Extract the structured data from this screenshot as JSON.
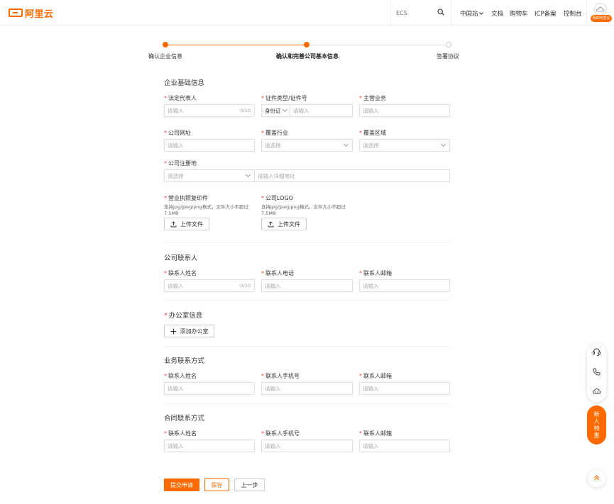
{
  "header": {
    "logo_text": "阿里云",
    "search_placeholder": "ECS",
    "nav": {
      "region": "中国站",
      "docs": "文档",
      "cart": "购物车",
      "icp": "ICP备案",
      "console": "控制台"
    },
    "avatar_badge": "我的阿里云"
  },
  "steps": [
    {
      "label": "确认企业信息",
      "state": "done"
    },
    {
      "label": "确认和完善公司基本信息",
      "state": "active"
    },
    {
      "label": "签署协议",
      "state": "pending"
    }
  ],
  "colors": {
    "accent": "#ff6a00",
    "required": "#f24545",
    "border": "#dddddd"
  },
  "basic": {
    "title": "企业基础信息",
    "legal_rep": {
      "label": "法定代表人",
      "placeholder": "请输入",
      "counter": "0/10"
    },
    "id_type": {
      "label": "证件类型/证件号",
      "selected": "身份证",
      "placeholder": "请输入"
    },
    "business": {
      "label": "主营业务",
      "placeholder": "请输入"
    },
    "website": {
      "label": "公司网址",
      "placeholder": "请输入"
    },
    "industry": {
      "label": "覆盖行业",
      "placeholder": "请选择"
    },
    "region": {
      "label": "覆盖区域",
      "placeholder": "请选择"
    },
    "reg_address": {
      "label": "公司注册地",
      "select_placeholder": "请选择",
      "detail_placeholder": "请输入详细地址"
    },
    "license": {
      "label": "营业执照复印件",
      "hint": "支持jpg/jpeg/png格式，文件大小不超过7.5MB",
      "button": "上传文件"
    },
    "logo": {
      "label": "公司LOGO",
      "hint": "支持jpg/jpeg/png格式，文件大小不超过7.5MB",
      "button": "上传文件"
    }
  },
  "contact": {
    "title": "公司联系人",
    "name": {
      "label": "联系人姓名",
      "placeholder": "请输入",
      "counter": "0/10"
    },
    "phone": {
      "label": "联系人电话",
      "placeholder": "请输入"
    },
    "email": {
      "label": "联系人邮箱",
      "placeholder": "请输入"
    }
  },
  "office": {
    "title": "办公室信息",
    "add_button": "添加办公室"
  },
  "business_contact": {
    "title": "业务联系方式",
    "name": {
      "label": "联系人姓名",
      "placeholder": "请输入"
    },
    "mobile": {
      "label": "联系人手机号",
      "placeholder": "请输入"
    },
    "email": {
      "label": "联系人邮箱",
      "placeholder": "请输入"
    }
  },
  "contract_contact": {
    "title": "合同联系方式",
    "name": {
      "label": "联系人姓名",
      "placeholder": "请输入"
    },
    "mobile": {
      "label": "联系人手机号",
      "placeholder": "请输入"
    },
    "email": {
      "label": "联系人邮箱",
      "placeholder": "请输入"
    }
  },
  "actions": {
    "submit": "提交申请",
    "save": "保存",
    "prev": "上一步"
  },
  "float": {
    "promo": [
      "新",
      "人",
      "特",
      "惠"
    ]
  }
}
